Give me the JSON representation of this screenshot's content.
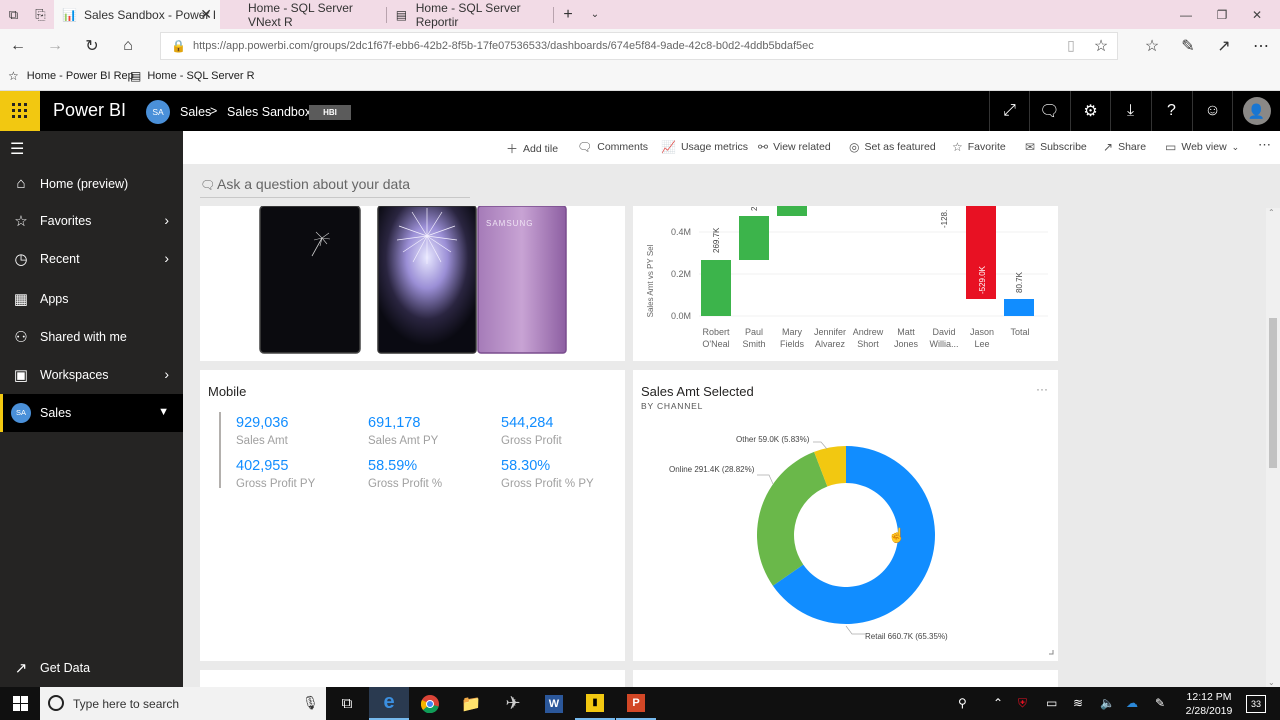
{
  "browser": {
    "tabs": [
      {
        "label": "Sales Sandbox - Power I",
        "active": true
      },
      {
        "label": "Home - SQL Server VNext R",
        "active": false
      },
      {
        "label": "Home - SQL Server Reportir",
        "active": false
      }
    ],
    "url": "https://app.powerbi.com/groups/2dc1f67f-ebb6-42b2-8f5b-17fe07536533/dashboards/674e5f84-9ade-42c8-b0d2-4ddb5bdaf5ec",
    "favorites": [
      "Home - Power BI Rep",
      "Home - SQL Server R"
    ]
  },
  "header": {
    "app_name": "Power BI",
    "avatar_initials": "SA",
    "breadcrumb_workspace": "Sales",
    "breadcrumb_separator": ">",
    "breadcrumb_dashboard": "Sales Sandbox",
    "badge": "HBI"
  },
  "leftnav": {
    "items": [
      {
        "label": "Home (preview)",
        "icon": "home-icon"
      },
      {
        "label": "Favorites",
        "icon": "star-icon"
      },
      {
        "label": "Recent",
        "icon": "clock-icon"
      },
      {
        "label": "Apps",
        "icon": "apps-icon"
      },
      {
        "label": "Shared with me",
        "icon": "shared-icon"
      },
      {
        "label": "Workspaces",
        "icon": "workspaces-icon"
      },
      {
        "label": "Sales",
        "icon": "avatar-icon",
        "avatar": "SA"
      }
    ],
    "get_data": "Get Data"
  },
  "actions": [
    "Add tile",
    "Comments",
    "Usage metrics",
    "View related",
    "Set as featured",
    "Favorite",
    "Subscribe",
    "Share",
    "Web view"
  ],
  "qna_placeholder": "Ask a question about your data",
  "waterfall": {
    "ylabel": "Sales Amt vs PY Sel",
    "yticks": [
      "0.4M",
      "0.2M",
      "0.0M"
    ],
    "categories": [
      "Robert O'Neal",
      "Paul Smith",
      "Mary Fields",
      "Jennifer Alvarez",
      "Andrew Short",
      "Matt Jones",
      "David Willia...",
      "Jason Lee",
      "Total"
    ],
    "category_lines": [
      [
        "Robert",
        "O'Neal"
      ],
      [
        "Paul",
        "Smith"
      ],
      [
        "Mary",
        "Fields"
      ],
      [
        "Jennifer",
        "Alvarez"
      ],
      [
        "Andrew",
        "Short"
      ],
      [
        "Matt",
        "Jones"
      ],
      [
        "David",
        "Willia..."
      ],
      [
        "Jason",
        "Lee"
      ],
      [
        "Total",
        ""
      ]
    ],
    "labels": [
      "269.7K",
      "2",
      "-128.",
      "-529.0K",
      "80.7K"
    ]
  },
  "mobile_tile": {
    "title": "Mobile",
    "kpis": [
      {
        "value": "929,036",
        "label": "Sales Amt"
      },
      {
        "value": "691,178",
        "label": "Sales Amt PY"
      },
      {
        "value": "544,284",
        "label": "Gross Profit"
      },
      {
        "value": "402,955",
        "label": "Gross Profit PY"
      },
      {
        "value": "58.59%",
        "label": "Gross Profit %"
      },
      {
        "value": "58.30%",
        "label": "Gross Profit % PY"
      }
    ]
  },
  "donut_tile": {
    "title": "Sales Amt Selected",
    "subtitle": "BY CHANNEL",
    "menu": "···",
    "slice_labels": [
      "Retail 660.7K (65.35%)",
      "Online 291.4K (28.82%)",
      "Other 59.0K (5.83%)"
    ]
  },
  "chart_data": [
    {
      "type": "waterfall",
      "categories": [
        "Robert O'Neal",
        "Paul Smith",
        "Mary Fields",
        "Jennifer Alvarez",
        "Andrew Short",
        "Matt Jones",
        "David Willia...",
        "Jason Lee",
        "Total"
      ],
      "values_k": [
        269.7,
        210,
        40,
        null,
        null,
        null,
        -128,
        -529.0,
        80.7
      ],
      "ylabel": "Sales Amt vs PY Sel",
      "ylim": [
        0,
        0.5
      ]
    },
    {
      "type": "pie",
      "title": "Sales Amt Selected",
      "subtitle": "BY CHANNEL",
      "categories": [
        "Retail",
        "Online",
        "Other"
      ],
      "values": [
        660.7,
        291.4,
        59.0
      ],
      "percents": [
        65.35,
        28.82,
        5.83
      ],
      "colors": [
        "#118dff",
        "#6ab84a",
        "#f2c811"
      ]
    }
  ],
  "taskbar": {
    "search_placeholder": "Type here to search",
    "time": "12:12 PM",
    "date": "2/28/2019",
    "notifications": "33"
  },
  "colors": {
    "accent": "#f2c811",
    "blue": "#118dff",
    "green": "#3cb44b",
    "red": "#e81123"
  }
}
